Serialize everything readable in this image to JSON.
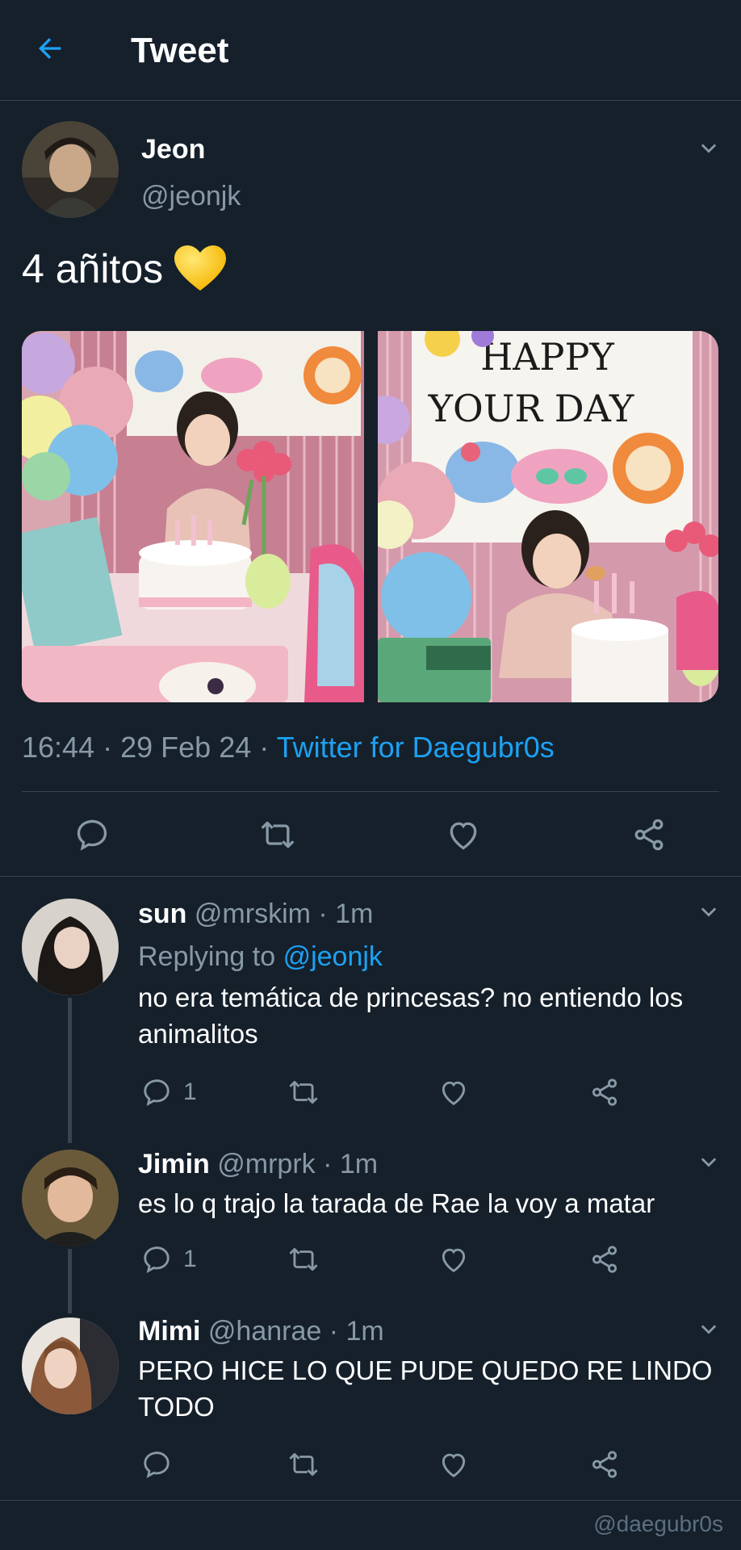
{
  "header": {
    "title": "Tweet",
    "back_icon": "arrow-left-icon",
    "accent": "#1da1f2"
  },
  "tweet": {
    "author_name": "Jeon",
    "author_handle": "@jeonjk",
    "text": "4 añitos",
    "emoji": "yellow-heart-emoji",
    "images": [
      {
        "banner_text": ""
      },
      {
        "banner_text": "HAPPY YOUR DAY"
      }
    ],
    "time": "16:44",
    "date": "29 Feb 24",
    "source": "Twitter for Daegubr0s",
    "separator": "·"
  },
  "replies": [
    {
      "name": "sun",
      "handle": "@mrskim",
      "time": "· 1m",
      "replying_label": "Replying to",
      "replying_handle": "@jeonjk",
      "text": "no era temática de princesas? no entiendo los animalitos",
      "reply_count": "1"
    },
    {
      "name": "Jimin",
      "handle": "@mrprk",
      "time": "· 1m",
      "text": "es lo q trajo la tarada de Rae la voy a matar",
      "reply_count": "1"
    },
    {
      "name": "Mimi",
      "handle": "@hanrae",
      "time": "· 1m",
      "text": "PERO HICE LO QUE PUDE QUEDO RE LINDO TODO",
      "reply_count": ""
    }
  ],
  "watermark": "@daegubr0s",
  "colors": {
    "background": "#15202b",
    "muted": "#8899a6",
    "link": "#1da1f2",
    "border": "#38444d"
  }
}
